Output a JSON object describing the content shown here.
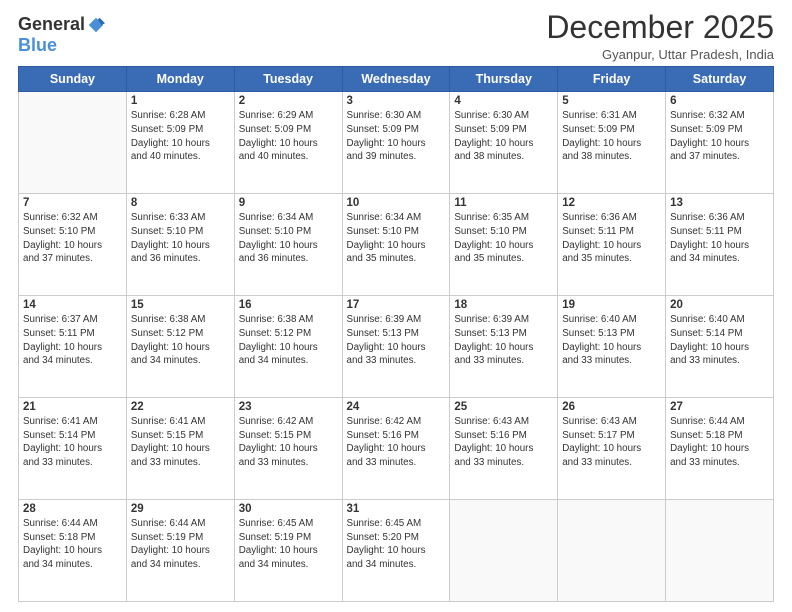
{
  "logo": {
    "general": "General",
    "blue": "Blue"
  },
  "header": {
    "title": "December 2025",
    "subtitle": "Gyanpur, Uttar Pradesh, India"
  },
  "weekdays": [
    "Sunday",
    "Monday",
    "Tuesday",
    "Wednesday",
    "Thursday",
    "Friday",
    "Saturday"
  ],
  "weeks": [
    [
      {
        "day": "",
        "info": ""
      },
      {
        "day": "1",
        "info": "Sunrise: 6:28 AM\nSunset: 5:09 PM\nDaylight: 10 hours\nand 40 minutes."
      },
      {
        "day": "2",
        "info": "Sunrise: 6:29 AM\nSunset: 5:09 PM\nDaylight: 10 hours\nand 40 minutes."
      },
      {
        "day": "3",
        "info": "Sunrise: 6:30 AM\nSunset: 5:09 PM\nDaylight: 10 hours\nand 39 minutes."
      },
      {
        "day": "4",
        "info": "Sunrise: 6:30 AM\nSunset: 5:09 PM\nDaylight: 10 hours\nand 38 minutes."
      },
      {
        "day": "5",
        "info": "Sunrise: 6:31 AM\nSunset: 5:09 PM\nDaylight: 10 hours\nand 38 minutes."
      },
      {
        "day": "6",
        "info": "Sunrise: 6:32 AM\nSunset: 5:09 PM\nDaylight: 10 hours\nand 37 minutes."
      }
    ],
    [
      {
        "day": "7",
        "info": "Sunrise: 6:32 AM\nSunset: 5:10 PM\nDaylight: 10 hours\nand 37 minutes."
      },
      {
        "day": "8",
        "info": "Sunrise: 6:33 AM\nSunset: 5:10 PM\nDaylight: 10 hours\nand 36 minutes."
      },
      {
        "day": "9",
        "info": "Sunrise: 6:34 AM\nSunset: 5:10 PM\nDaylight: 10 hours\nand 36 minutes."
      },
      {
        "day": "10",
        "info": "Sunrise: 6:34 AM\nSunset: 5:10 PM\nDaylight: 10 hours\nand 35 minutes."
      },
      {
        "day": "11",
        "info": "Sunrise: 6:35 AM\nSunset: 5:10 PM\nDaylight: 10 hours\nand 35 minutes."
      },
      {
        "day": "12",
        "info": "Sunrise: 6:36 AM\nSunset: 5:11 PM\nDaylight: 10 hours\nand 35 minutes."
      },
      {
        "day": "13",
        "info": "Sunrise: 6:36 AM\nSunset: 5:11 PM\nDaylight: 10 hours\nand 34 minutes."
      }
    ],
    [
      {
        "day": "14",
        "info": "Sunrise: 6:37 AM\nSunset: 5:11 PM\nDaylight: 10 hours\nand 34 minutes."
      },
      {
        "day": "15",
        "info": "Sunrise: 6:38 AM\nSunset: 5:12 PM\nDaylight: 10 hours\nand 34 minutes."
      },
      {
        "day": "16",
        "info": "Sunrise: 6:38 AM\nSunset: 5:12 PM\nDaylight: 10 hours\nand 34 minutes."
      },
      {
        "day": "17",
        "info": "Sunrise: 6:39 AM\nSunset: 5:13 PM\nDaylight: 10 hours\nand 33 minutes."
      },
      {
        "day": "18",
        "info": "Sunrise: 6:39 AM\nSunset: 5:13 PM\nDaylight: 10 hours\nand 33 minutes."
      },
      {
        "day": "19",
        "info": "Sunrise: 6:40 AM\nSunset: 5:13 PM\nDaylight: 10 hours\nand 33 minutes."
      },
      {
        "day": "20",
        "info": "Sunrise: 6:40 AM\nSunset: 5:14 PM\nDaylight: 10 hours\nand 33 minutes."
      }
    ],
    [
      {
        "day": "21",
        "info": "Sunrise: 6:41 AM\nSunset: 5:14 PM\nDaylight: 10 hours\nand 33 minutes."
      },
      {
        "day": "22",
        "info": "Sunrise: 6:41 AM\nSunset: 5:15 PM\nDaylight: 10 hours\nand 33 minutes."
      },
      {
        "day": "23",
        "info": "Sunrise: 6:42 AM\nSunset: 5:15 PM\nDaylight: 10 hours\nand 33 minutes."
      },
      {
        "day": "24",
        "info": "Sunrise: 6:42 AM\nSunset: 5:16 PM\nDaylight: 10 hours\nand 33 minutes."
      },
      {
        "day": "25",
        "info": "Sunrise: 6:43 AM\nSunset: 5:16 PM\nDaylight: 10 hours\nand 33 minutes."
      },
      {
        "day": "26",
        "info": "Sunrise: 6:43 AM\nSunset: 5:17 PM\nDaylight: 10 hours\nand 33 minutes."
      },
      {
        "day": "27",
        "info": "Sunrise: 6:44 AM\nSunset: 5:18 PM\nDaylight: 10 hours\nand 33 minutes."
      }
    ],
    [
      {
        "day": "28",
        "info": "Sunrise: 6:44 AM\nSunset: 5:18 PM\nDaylight: 10 hours\nand 34 minutes."
      },
      {
        "day": "29",
        "info": "Sunrise: 6:44 AM\nSunset: 5:19 PM\nDaylight: 10 hours\nand 34 minutes."
      },
      {
        "day": "30",
        "info": "Sunrise: 6:45 AM\nSunset: 5:19 PM\nDaylight: 10 hours\nand 34 minutes."
      },
      {
        "day": "31",
        "info": "Sunrise: 6:45 AM\nSunset: 5:20 PM\nDaylight: 10 hours\nand 34 minutes."
      },
      {
        "day": "",
        "info": ""
      },
      {
        "day": "",
        "info": ""
      },
      {
        "day": "",
        "info": ""
      }
    ]
  ]
}
